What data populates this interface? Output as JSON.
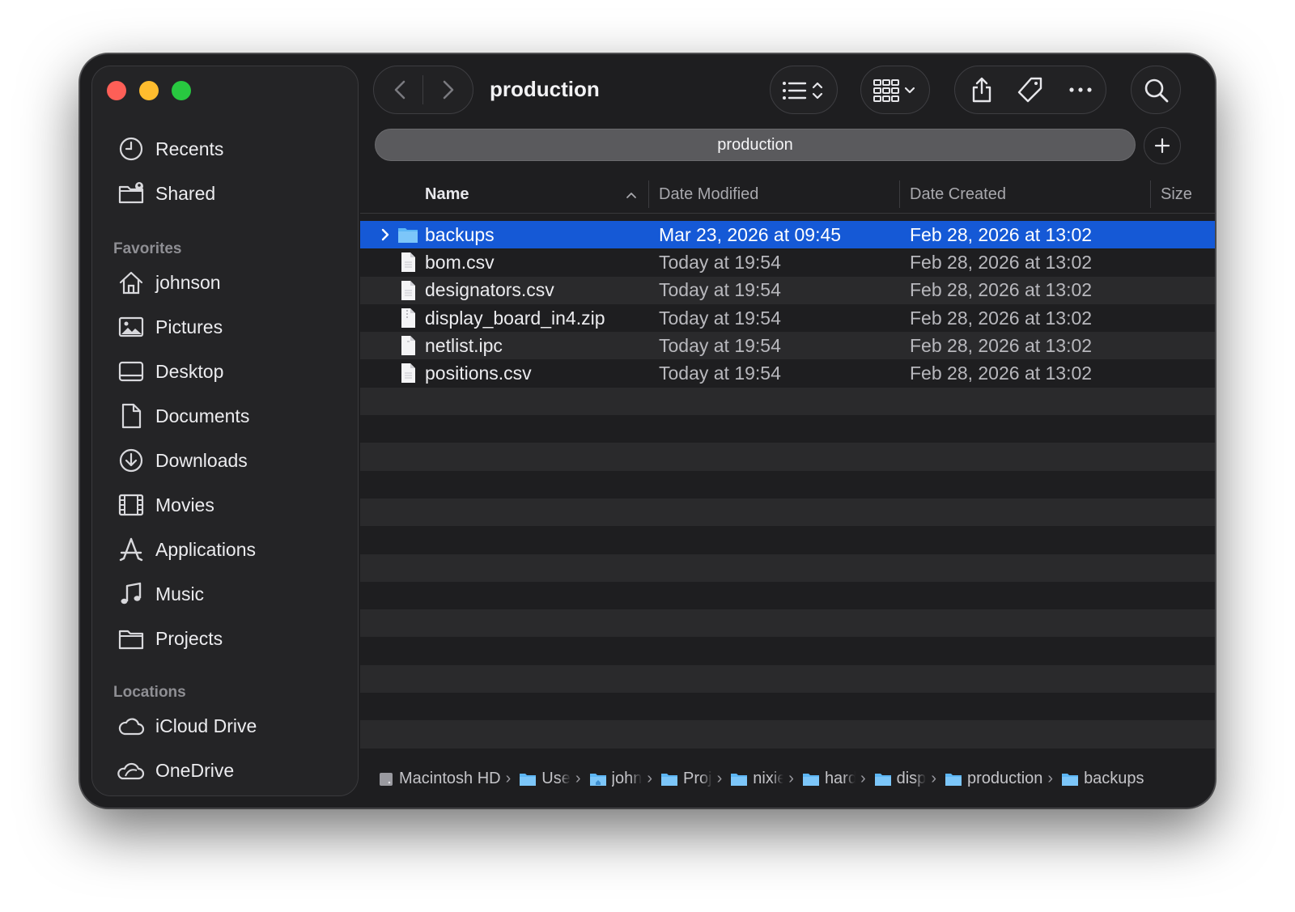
{
  "window": {
    "title": "production"
  },
  "tab": {
    "label": "production"
  },
  "sidebar": {
    "top_items": [
      {
        "label": "Recents",
        "icon": "clock-icon"
      },
      {
        "label": "Shared",
        "icon": "shared-folder-icon"
      }
    ],
    "favorites_title": "Favorites",
    "favorites": [
      {
        "label": "johnson",
        "icon": "home-icon"
      },
      {
        "label": "Pictures",
        "icon": "photo-icon"
      },
      {
        "label": "Desktop",
        "icon": "desktop-icon"
      },
      {
        "label": "Documents",
        "icon": "document-icon"
      },
      {
        "label": "Downloads",
        "icon": "download-icon"
      },
      {
        "label": "Movies",
        "icon": "film-icon"
      },
      {
        "label": "Applications",
        "icon": "applications-icon"
      },
      {
        "label": "Music",
        "icon": "music-note-icon"
      },
      {
        "label": "Projects",
        "icon": "folder-icon"
      }
    ],
    "locations_title": "Locations",
    "locations": [
      {
        "label": "iCloud Drive",
        "icon": "cloud-icon"
      },
      {
        "label": "OneDrive",
        "icon": "onedrive-icon"
      }
    ]
  },
  "columns": {
    "name": "Name",
    "modified": "Date Modified",
    "created": "Date Created",
    "size": "Size"
  },
  "files": [
    {
      "name": "backups",
      "modified": "Mar 23, 2026 at 09:45",
      "created": "Feb 28, 2026 at 13:02",
      "kind": "folder",
      "selected": true
    },
    {
      "name": "bom.csv",
      "modified": "Today at 19:54",
      "created": "Feb 28, 2026 at 13:02",
      "kind": "file"
    },
    {
      "name": "designators.csv",
      "modified": "Today at 19:54",
      "created": "Feb 28, 2026 at 13:02",
      "kind": "file"
    },
    {
      "name": "display_board_in4.zip",
      "modified": "Today at 19:54",
      "created": "Feb 28, 2026 at 13:02",
      "kind": "file"
    },
    {
      "name": "netlist.ipc",
      "modified": "Today at 19:54",
      "created": "Feb 28, 2026 at 13:02",
      "kind": "file"
    },
    {
      "name": "positions.csv",
      "modified": "Today at 19:54",
      "created": "Feb 28, 2026 at 13:02",
      "kind": "file"
    }
  ],
  "path": [
    {
      "label": "Macintosh HD",
      "icon": "disk-icon"
    },
    {
      "label": "Use",
      "icon": "folder-icon",
      "truncated": true
    },
    {
      "label": "john",
      "icon": "folder-icon",
      "truncated": true
    },
    {
      "label": "Proj",
      "icon": "folder-icon",
      "truncated": true
    },
    {
      "label": "nixie",
      "icon": "folder-icon",
      "truncated": true
    },
    {
      "label": "hard",
      "icon": "folder-icon",
      "truncated": true
    },
    {
      "label": "disp",
      "icon": "folder-icon",
      "truncated": true
    },
    {
      "label": "production",
      "icon": "folder-icon"
    },
    {
      "label": "backups",
      "icon": "folder-icon"
    }
  ],
  "colors": {
    "selection": "#1559d6",
    "folder": "#5cb6f5",
    "window_bg": "#1e1e20"
  }
}
